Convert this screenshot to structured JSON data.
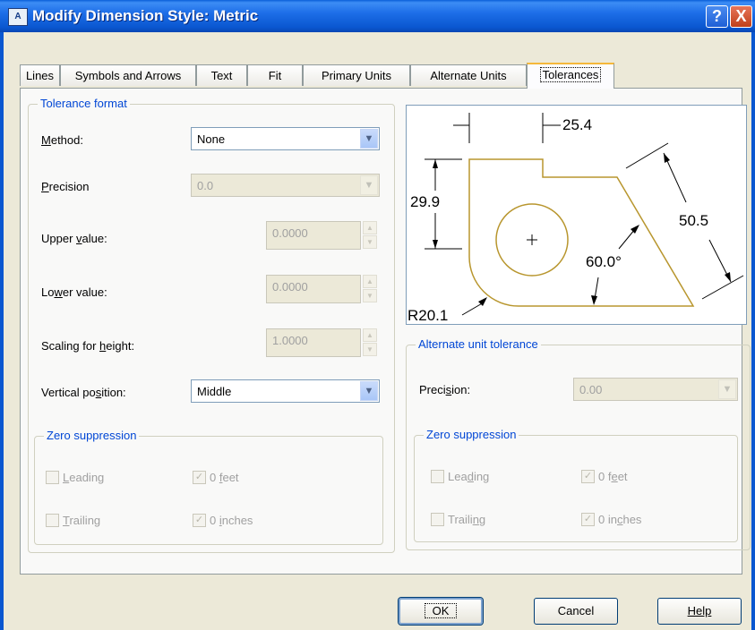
{
  "window": {
    "title": "Modify Dimension Style: Metric",
    "help_glyph": "?",
    "close_glyph": "X",
    "app_icon_text": "A"
  },
  "tabs": [
    "Lines",
    "Symbols and Arrows",
    "Text",
    "Fit",
    "Primary Units",
    "Alternate Units",
    "Tolerances"
  ],
  "active_tab": "Tolerances",
  "tolerance_format": {
    "title": "Tolerance format",
    "method": {
      "label": "Method:",
      "value": "None"
    },
    "precision": {
      "label": "Precision",
      "value": "0.0"
    },
    "upper": {
      "label": "Upper value:",
      "value": "0.0000"
    },
    "lower": {
      "label": "Lower value:",
      "value": "0.0000"
    },
    "scaling": {
      "label": "Scaling for height:",
      "value": "1.0000"
    },
    "vertical": {
      "label": "Vertical position:",
      "value": "Middle"
    },
    "zero": {
      "title": "Zero suppression",
      "leading": "Leading",
      "trailing": "Trailing",
      "feet": "0 feet",
      "inches": "0 inches",
      "leading_checked": false,
      "trailing_checked": false,
      "feet_checked": true,
      "inches_checked": true
    }
  },
  "preview": {
    "dim_top": "25.4",
    "dim_left": "29.9",
    "dim_right": "50.5",
    "angle": "60.0°",
    "radius": "R20.1",
    "outline_color": "#b8962e"
  },
  "alt_tolerance": {
    "title": "Alternate unit tolerance",
    "precision": {
      "label": "Precision:",
      "value": "0.00"
    },
    "zero": {
      "title": "Zero suppression",
      "leading": "Leading",
      "trailing": "Trailing",
      "feet": "0 feet",
      "inches": "0 inches",
      "leading_checked": false,
      "trailing_checked": false,
      "feet_checked": true,
      "inches_checked": true
    }
  },
  "buttons": {
    "ok": "OK",
    "cancel": "Cancel",
    "help": "Help"
  }
}
